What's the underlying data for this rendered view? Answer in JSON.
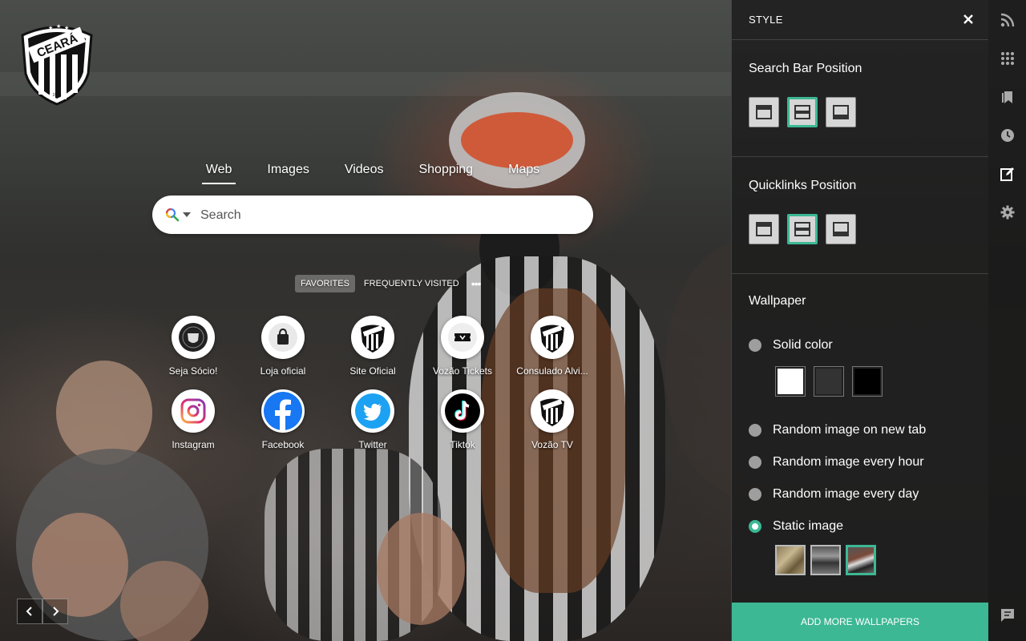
{
  "search": {
    "tabs": [
      {
        "label": "Web",
        "active": true
      },
      {
        "label": "Images",
        "active": false
      },
      {
        "label": "Videos",
        "active": false
      },
      {
        "label": "Shopping",
        "active": false
      },
      {
        "label": "Maps",
        "active": false
      }
    ],
    "placeholder": "Search"
  },
  "quicklinks": {
    "tabs": [
      "FAVORITES",
      "FREQUENTLY VISITED"
    ],
    "more": "•••",
    "items": [
      {
        "label": "Seja Sócio!",
        "icon": "seja-socio-icon"
      },
      {
        "label": "Loja oficial",
        "icon": "shopping-bag-icon"
      },
      {
        "label": "Site Oficial",
        "icon": "ceara-crest-icon"
      },
      {
        "label": "Vozão Tickets",
        "icon": "ticket-icon"
      },
      {
        "label": "Consulado Alvi...",
        "icon": "ceara-crest-icon"
      },
      {
        "label": "Instagram",
        "icon": "instagram-icon"
      },
      {
        "label": "Facebook",
        "icon": "facebook-icon"
      },
      {
        "label": "Twitter",
        "icon": "twitter-icon"
      },
      {
        "label": "Tiktok",
        "icon": "tiktok-icon"
      },
      {
        "label": "Vozão TV",
        "icon": "ceara-crest-icon"
      }
    ]
  },
  "logo": {
    "text": "CEARÁ",
    "year": "1914"
  },
  "panel": {
    "title": "STYLE",
    "search_bar_position": {
      "label": "Search Bar Position",
      "selected": "middle"
    },
    "quicklinks_position": {
      "label": "Quicklinks Position",
      "selected": "middle"
    },
    "wallpaper": {
      "label": "Wallpaper",
      "options": [
        {
          "label": "Solid color",
          "selected": false
        },
        {
          "label": "Random image on new tab",
          "selected": false
        },
        {
          "label": "Random image every hour",
          "selected": false
        },
        {
          "label": "Random image every day",
          "selected": false
        },
        {
          "label": "Static image",
          "selected": true
        }
      ],
      "solid_colors": [
        "#ffffff",
        "#333333",
        "#000000"
      ],
      "static_thumbs_selected": 3
    },
    "add_button": "ADD MORE WALLPAPERS"
  },
  "colors": {
    "accent": "#3cb894"
  },
  "sidebar": [
    "rss-icon",
    "apps-grid-icon",
    "bookmark-icon",
    "history-clock-icon",
    "style-edit-icon",
    "settings-gear-icon",
    "feedback-icon"
  ]
}
